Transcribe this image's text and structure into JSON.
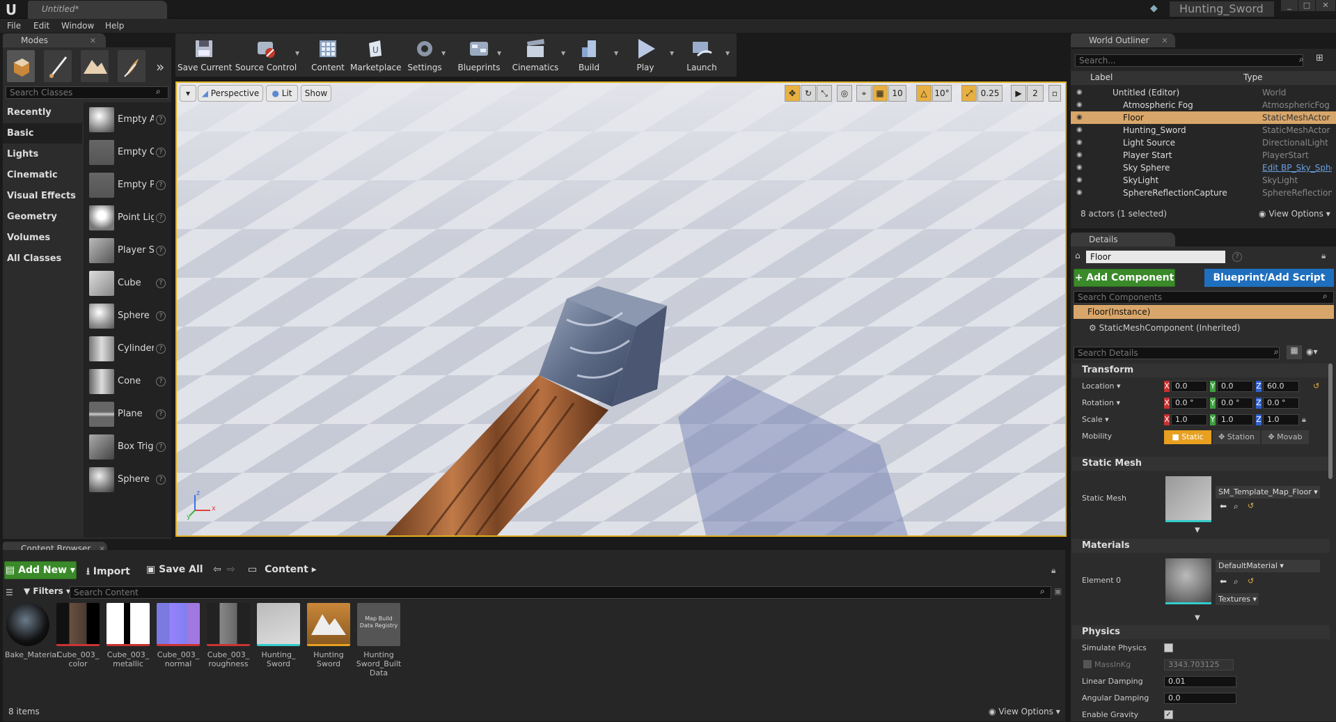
{
  "window": {
    "tab_title": "Untitled*",
    "project_name": "Hunting_Sword"
  },
  "menu": [
    "File",
    "Edit",
    "Window",
    "Help"
  ],
  "modes": {
    "tab_label": "Modes",
    "search_placeholder": "Search Classes",
    "categories": [
      "Recently Placed",
      "Basic",
      "Lights",
      "Cinematic",
      "Visual Effects",
      "Geometry",
      "Volumes",
      "All Classes"
    ],
    "selected_category": "Basic",
    "items": [
      "Empty A",
      "Empty C",
      "Empty P",
      "Point Lig",
      "Player S",
      "Cube",
      "Sphere",
      "Cylinder",
      "Cone",
      "Plane",
      "Box Trig",
      "Sphere "
    ]
  },
  "toolbar": {
    "buttons": [
      "Save Current",
      "Source Control",
      "Content",
      "Marketplace",
      "Settings",
      "Blueprints",
      "Cinematics",
      "Build",
      "Play",
      "Launch"
    ]
  },
  "viewport": {
    "perspective_label": "Perspective",
    "lit_label": "Lit",
    "show_label": "Show",
    "grid_snap": "10",
    "rotation_snap": "10°",
    "scale_snap": "0.25",
    "camera_speed": "2",
    "axis_z": "z",
    "axis_x": "x",
    "axis_y": "y"
  },
  "outliner": {
    "tab_label": "World Outliner",
    "search_placeholder": "Search...",
    "col_label": "Label",
    "col_type": "Type",
    "rows": [
      {
        "label": "Untitled (Editor)",
        "type": "World"
      },
      {
        "label": "Atmospheric Fog",
        "type": "AtmosphericFog"
      },
      {
        "label": "Floor",
        "type": "StaticMeshActor"
      },
      {
        "label": "Hunting_Sword",
        "type": "StaticMeshActor"
      },
      {
        "label": "Light Source",
        "type": "DirectionalLight"
      },
      {
        "label": "Player Start",
        "type": "PlayerStart"
      },
      {
        "label": "Sky Sphere",
        "type": "Edit BP_Sky_Sphe"
      },
      {
        "label": "SkyLight",
        "type": "SkyLight"
      },
      {
        "label": "SphereReflectionCapture",
        "type": "SphereReflectionC"
      }
    ],
    "selected": "Floor",
    "status": "8 actors (1 selected)",
    "view_options": "View Options"
  },
  "details": {
    "tab_label": "Details",
    "name_value": "Floor",
    "add_component": "+ Add Component",
    "blueprint_script": "Blueprint/Add Script",
    "search_components": "Search Components",
    "instance_label": "Floor(Instance)",
    "component_label": "StaticMeshComponent (Inherited)",
    "search_details": "Search Details",
    "transform": {
      "section": "Transform",
      "location_label": "Location",
      "rotation_label": "Rotation",
      "scale_label": "Scale",
      "mobility_label": "Mobility",
      "location": [
        "0.0",
        "0.0",
        "60.0"
      ],
      "rotation": [
        "0.0 °",
        "0.0 °",
        "0.0 °"
      ],
      "scale": [
        "1.0",
        "1.0",
        "1.0"
      ],
      "mobility": [
        "Static",
        "Station",
        "Movab"
      ],
      "axis_x": "X",
      "axis_y": "Y",
      "axis_z": "Z"
    },
    "static_mesh": {
      "section": "Static Mesh",
      "label": "Static Mesh",
      "value": "SM_Template_Map_Floor"
    },
    "materials": {
      "section": "Materials",
      "element_label": "Element 0",
      "value": "DefaultMaterial",
      "textures": "Textures"
    },
    "physics": {
      "section": "Physics",
      "simulate_label": "Simulate Physics",
      "mass_label": "MassInKg",
      "mass_value": "3343.703125",
      "linear_label": "Linear Damping",
      "linear_value": "0.01",
      "angular_label": "Angular Damping",
      "angular_value": "0.0",
      "gravity_label": "Enable Gravity"
    }
  },
  "content_browser": {
    "tab_label": "Content Browser",
    "add_new": "Add New",
    "import": "Import",
    "save_all": "Save All",
    "folder": "Content",
    "filters": "Filters",
    "search_placeholder": "Search Content",
    "assets": [
      "Bake_Material",
      "Cube_003_\ncolor",
      "Cube_003_\nmetallic",
      "Cube_003_\nnormal",
      "Cube_003_\nroughness",
      "Hunting_\nSword",
      "Hunting\nSword",
      "Hunting\nSword_Built\nData"
    ],
    "map_registry_thumb": "Map Build\nData Registry",
    "item_count": "8 items",
    "view_options": "View Options"
  },
  "colors": {
    "accent": "#e0b020",
    "selection": "#d8a66a",
    "green": "#3a8a2a",
    "blue": "#1f6fbf"
  }
}
